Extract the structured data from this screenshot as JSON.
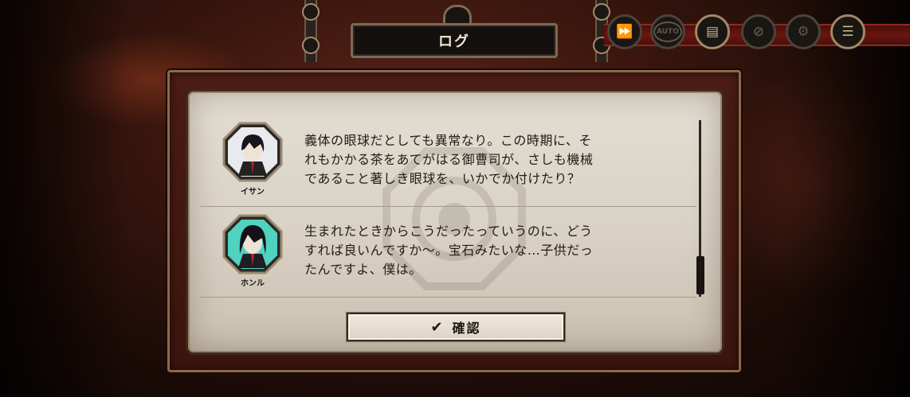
{
  "header": {
    "title": "ログ"
  },
  "toolbar": {
    "buttons": [
      {
        "name": "fast-forward",
        "glyph": "⏩",
        "active": false
      },
      {
        "name": "auto",
        "glyph": "AUTO",
        "active": false
      },
      {
        "name": "log",
        "glyph": "▤",
        "active": true
      },
      {
        "name": "hide-ui",
        "glyph": "⊘",
        "active": false
      },
      {
        "name": "settings",
        "glyph": "⚙",
        "active": false
      },
      {
        "name": "menu",
        "glyph": "☰",
        "active": true
      }
    ]
  },
  "log": {
    "entries": [
      {
        "speaker": "イサン",
        "text": "義体の眼球だとしても異常なり。この時期に、そ\nれもかかる茶をあてがはる御曹司が、さしも機械\nであること著しき眼球を、いかでか付けたり？"
      },
      {
        "speaker": "ホンル",
        "text": "生まれたときからこうだったっていうのに、どう\nすれば良いんですか〜。宝石みたいな…子供だっ\nたんですよ、僕は。"
      }
    ]
  },
  "confirm": {
    "label": "確認"
  },
  "colors": {
    "accent": "#8a6a4c",
    "panel": "#d8d1c4",
    "toolbar_red": "#6a1510"
  }
}
